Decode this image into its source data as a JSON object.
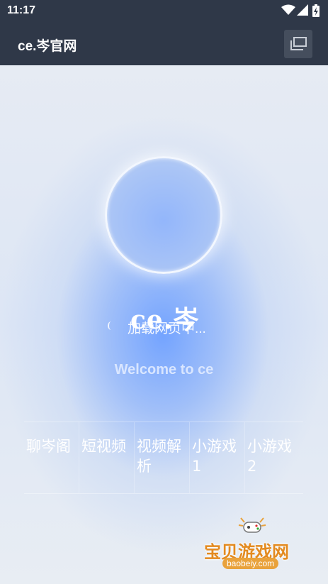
{
  "status_bar": {
    "time": "11:17"
  },
  "app_bar": {
    "title": "ce.岑官网"
  },
  "loading": {
    "brand": "ce.岑",
    "text": "加载网页中..."
  },
  "welcome": "Welcome to ce",
  "nav": {
    "items": [
      {
        "label": "聊岑阁"
      },
      {
        "label": "短视频"
      },
      {
        "label": "视频解析"
      },
      {
        "label": "小游戏1"
      },
      {
        "label": "小游戏2"
      }
    ]
  },
  "watermark": {
    "text": "宝贝游戏网",
    "url": "baobeiy.com"
  },
  "colors": {
    "bar_bg": "#2f3848",
    "accent_blue": "#6ea0ff",
    "watermark_orange": "#e38a1f"
  }
}
